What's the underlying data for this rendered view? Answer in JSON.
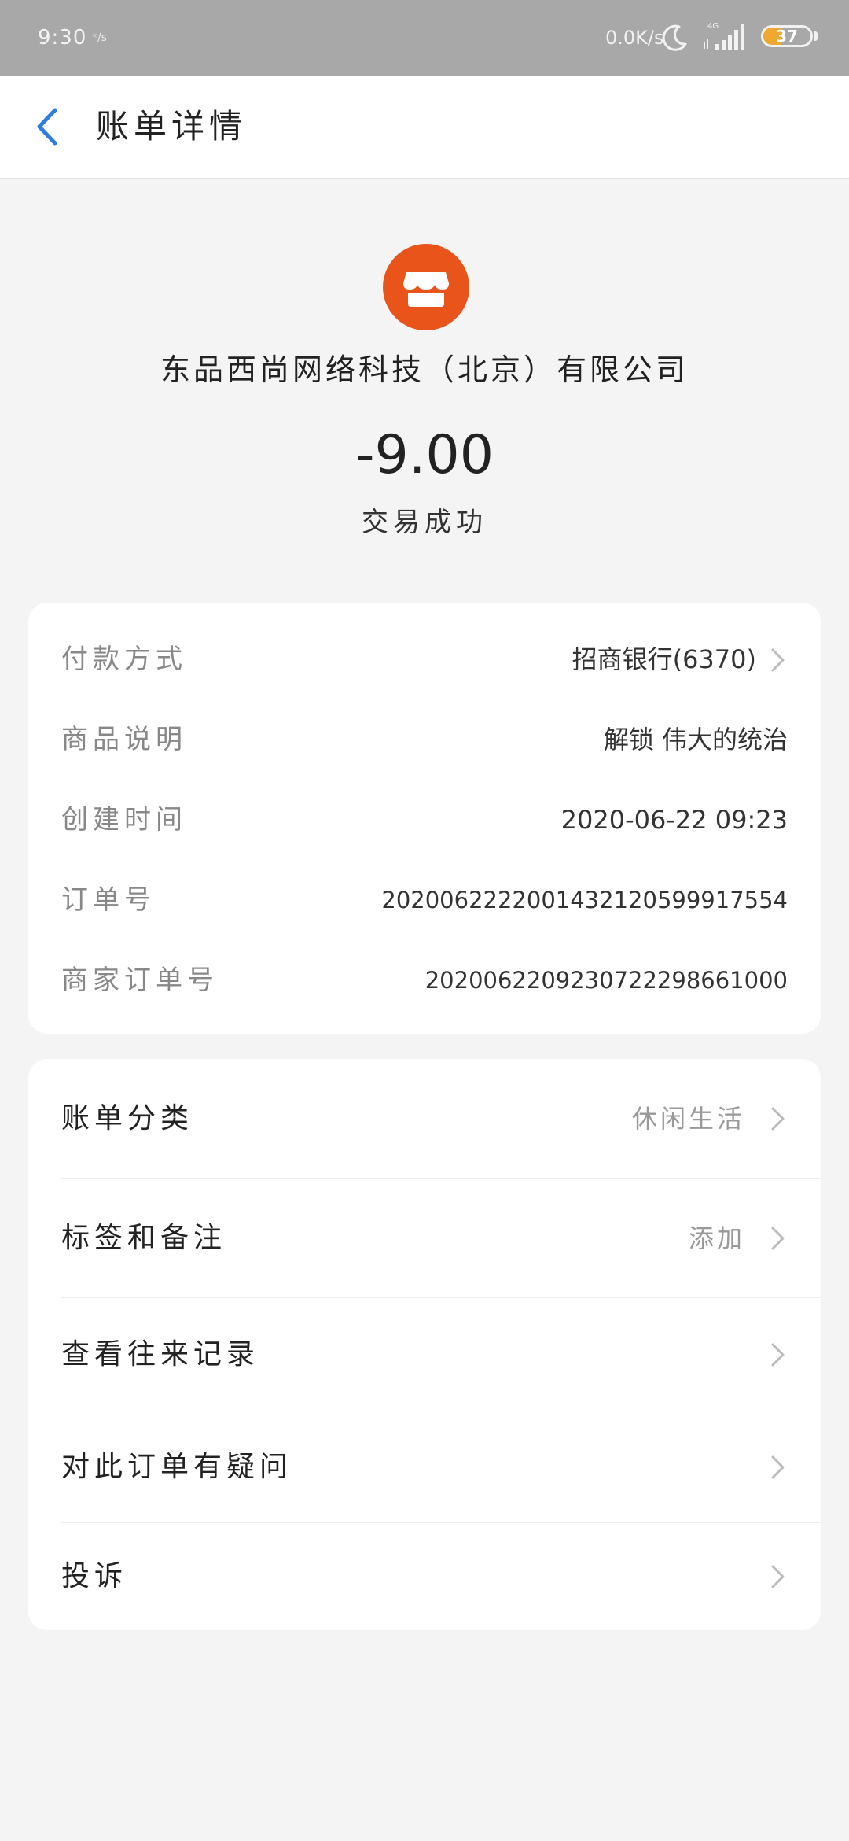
{
  "status_bar": {
    "time": "9:30",
    "small_icon": "ᵏ/s",
    "speed": "0.0K/s",
    "network": "4G",
    "battery": "37",
    "battery_level": 0.37,
    "icons": [
      "moon-icon",
      "signal-icon",
      "battery-icon"
    ]
  },
  "nav": {
    "title": "账单详情",
    "back_icon": "chevron-left-icon"
  },
  "colors": {
    "accent_blue": "#2f7de1",
    "shop_orange": "#e8541a",
    "battery_orange": "#f0a830",
    "status_bar_bg": "#a8a8a8"
  },
  "merchant": {
    "icon": "shop-icon",
    "name": "东品西尚网络科技（北京）有限公司"
  },
  "transaction": {
    "amount": "-9.00",
    "status": "交易成功"
  },
  "details": {
    "payment_method_label": "付款方式",
    "payment_method_value": "招商银行(6370)",
    "product_desc_label": "商品说明",
    "product_desc_value": "解锁 伟大的统治",
    "created_time_label": "创建时间",
    "created_time_value": "2020-06-22 09:23",
    "order_no_label": "订单号",
    "order_no_value": "2020062222001432120599917554",
    "merchant_order_no_label": "商家订单号",
    "merchant_order_no_value": "2020062209230722298661000"
  },
  "actions": {
    "bill_category_label": "账单分类",
    "bill_category_value": "休闲生活",
    "tags_notes_label": "标签和备注",
    "tags_notes_value": "添加",
    "view_records_label": "查看往来记录",
    "order_question_label": "对此订单有疑问",
    "complaint_label": "投诉"
  }
}
